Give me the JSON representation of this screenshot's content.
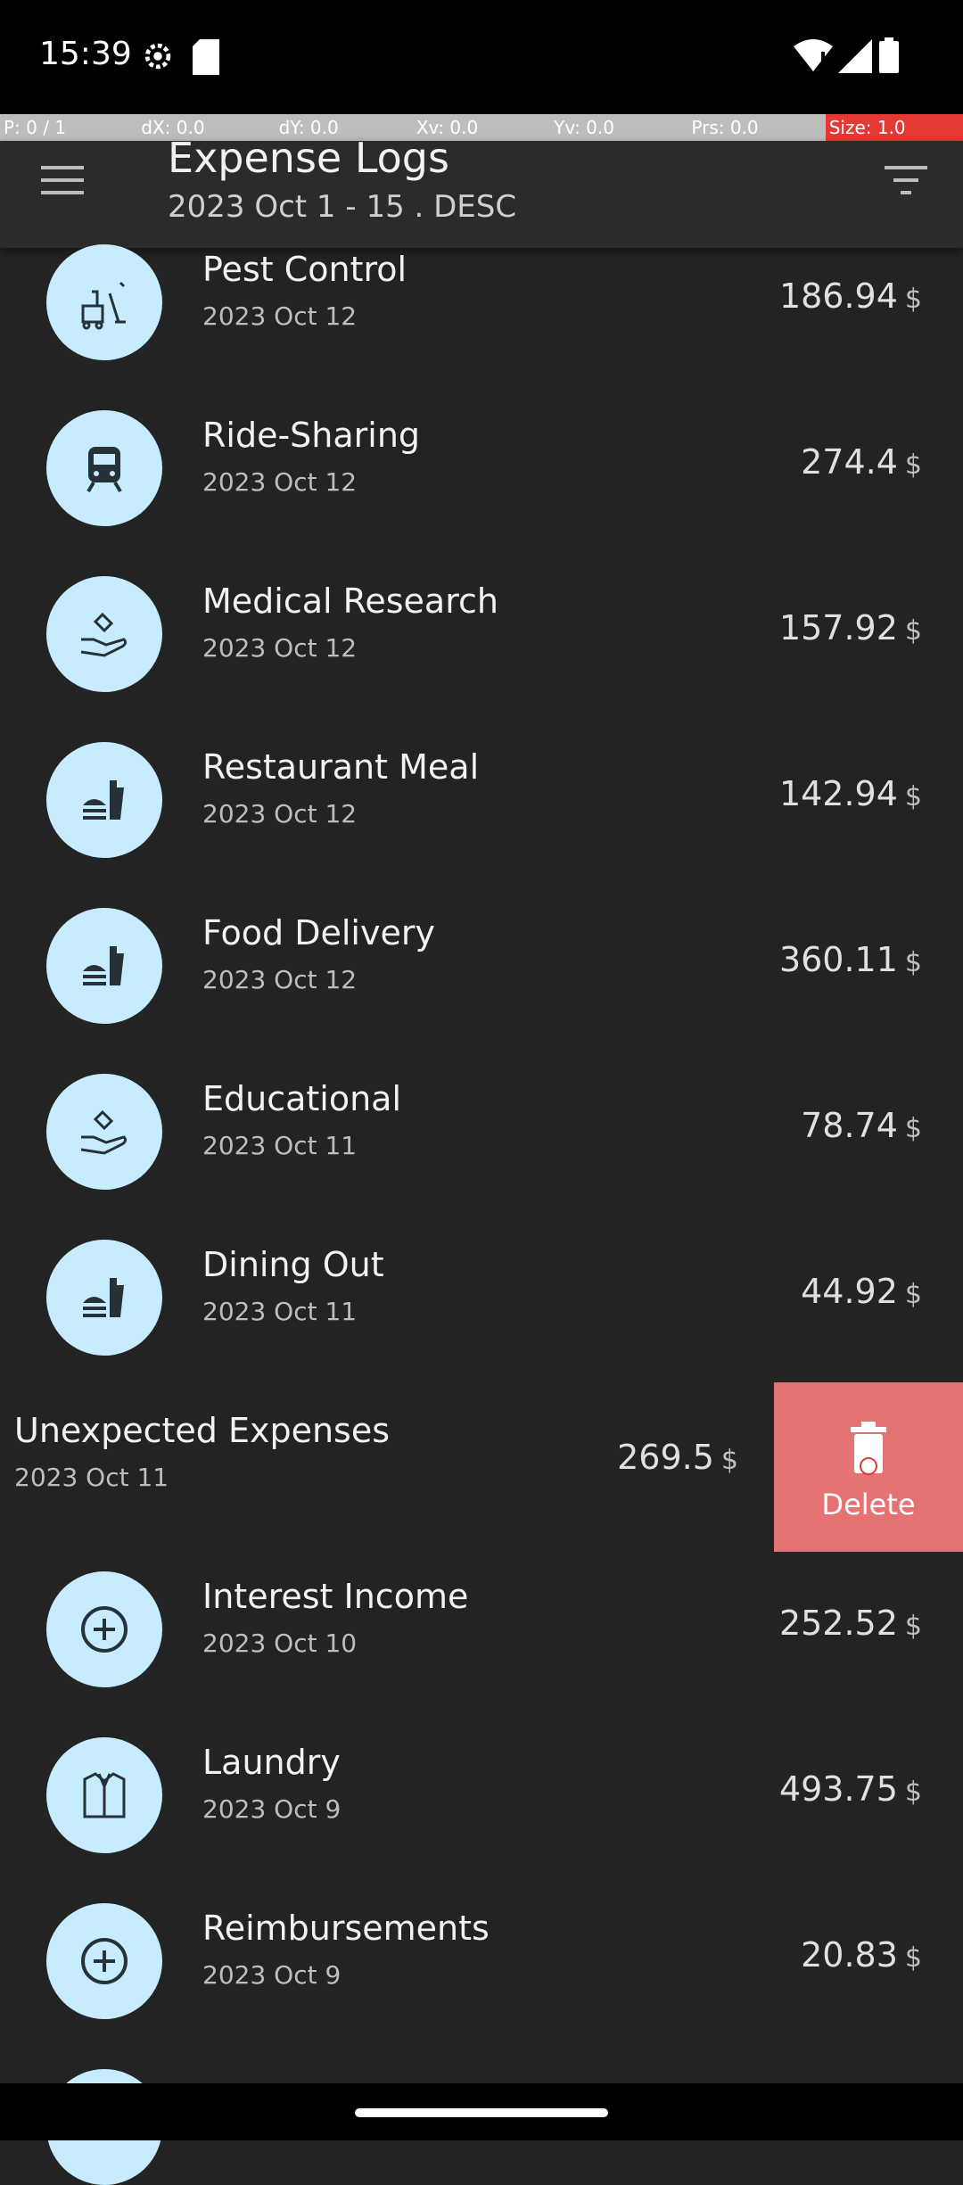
{
  "status_bar": {
    "time": "15:39"
  },
  "debug_bar": {
    "pointers": "P: 0 / 1",
    "dx": "dX: 0.0",
    "dy": "dY: 0.0",
    "xv": "Xv: 0.0",
    "yv": "Yv: 0.0",
    "prs": "Prs: 0.0",
    "size": "Size: 1.0"
  },
  "header": {
    "title": "Expense Logs",
    "subtitle": "2023 Oct 1 - 15 . DESC",
    "menu_icon": "hamburger-menu-icon",
    "filter_icon": "filter-icon"
  },
  "expenses": [
    {
      "title": "Pest Control",
      "date": "2023 Oct 12",
      "amount": "186.94",
      "currency": "$",
      "icon": "cleaning-icon"
    },
    {
      "title": "Ride-Sharing",
      "date": "2023 Oct 12",
      "amount": "274.4",
      "currency": "$",
      "icon": "train-icon"
    },
    {
      "title": "Medical Research",
      "date": "2023 Oct 12",
      "amount": "157.92",
      "currency": "$",
      "icon": "donation-hand-icon"
    },
    {
      "title": "Restaurant Meal",
      "date": "2023 Oct 12",
      "amount": "142.94",
      "currency": "$",
      "icon": "fastfood-icon"
    },
    {
      "title": "Food Delivery",
      "date": "2023 Oct 12",
      "amount": "360.11",
      "currency": "$",
      "icon": "fastfood-icon"
    },
    {
      "title": "Educational",
      "date": "2023 Oct 11",
      "amount": "78.74",
      "currency": "$",
      "icon": "donation-hand-icon"
    },
    {
      "title": "Dining Out",
      "date": "2023 Oct 11",
      "amount": "44.92",
      "currency": "$",
      "icon": "fastfood-icon"
    },
    {
      "title": "Unexpected Expenses",
      "date": "2023 Oct 11",
      "amount": "269.5",
      "currency": "$",
      "icon": ""
    },
    {
      "title": "Interest Income",
      "date": "2023 Oct 10",
      "amount": "252.52",
      "currency": "$",
      "icon": "add-circle-icon"
    },
    {
      "title": "Laundry",
      "date": "2023 Oct 9",
      "amount": "493.75",
      "currency": "$",
      "icon": "shirt-icon"
    },
    {
      "title": "Reimbursements",
      "date": "2023 Oct 9",
      "amount": "20.83",
      "currency": "$",
      "icon": "add-circle-icon"
    }
  ],
  "swipe_action": {
    "label": "Delete",
    "icon": "trash-icon"
  }
}
